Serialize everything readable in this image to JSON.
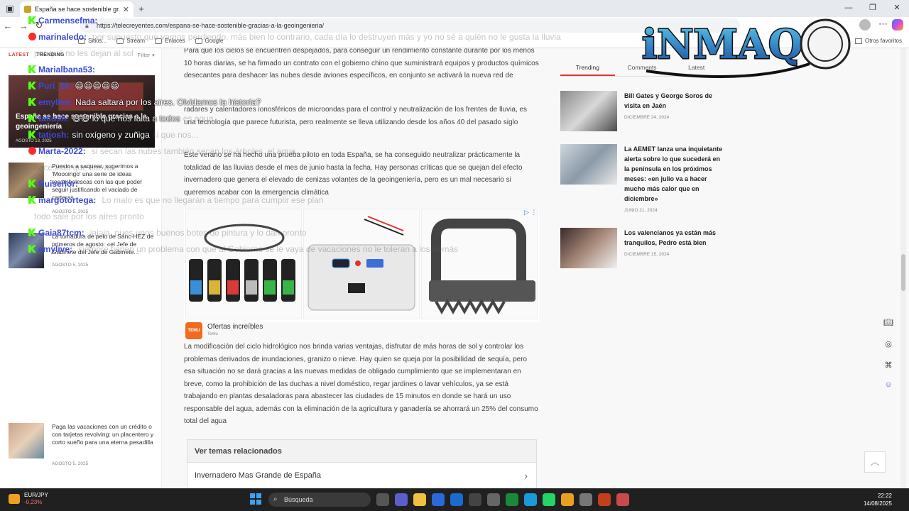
{
  "browser": {
    "tab_title": "España se hace sostenible gracias a la geoingeniería",
    "url": "https://telecreyentes.com/espana-se-hace-sostenible-gracias-a-la-geoingenieria/",
    "bookmarks": [
      "Sitios...",
      "Stream",
      "Enlaces",
      "Google"
    ],
    "other_bookmarks": "Otros favoritos"
  },
  "left": {
    "tabs": [
      "LATEST",
      "TRENDING"
    ],
    "filter": "Filter ▾",
    "featured": {
      "title": "España se hace sostenible gracias a la geoingeniería",
      "date": "AGOSTO 13, 2025"
    },
    "items": [
      {
        "title": "Puestos a saquear, sugerimos a 'Moooingo' una serie de ideas rocambolescas con las que poder seguir justificando el vaciado de carteras",
        "date": "AGOSTO 5, 2025"
      },
      {
        "title": "La tomadura de pelo de Sánc-HEZ de primeros de agosto: «el Jefe de Gabinete del Jefe de Gabinete...",
        "date": "AGOSTO 5, 2025"
      },
      {
        "title": "Paga las vacaciones con un crédito o con tarjetas revolving: un placentero y corto sueño para una eterna pesadilla",
        "date": "AGOSTO 5, 2025"
      }
    ]
  },
  "article": {
    "p1": "Para que los cielos se encuentren despejados, para conseguir un rendimiento constante durante por los menos 10 horas diarias, se ha firmado un contrato con el gobierno chino que suministrará equipos y productos químicos desecantes para deshacer las nubes desde aviones específicos, en conjunto se activará la nueva red de",
    "p2": "radares y calentadores ionosféricos de microondas para el control y neutralización de los frentes de lluvia, es una tecnología que parece futurista, pero realmente se lleva utilizando desde los años 40 del pasado siglo",
    "p3": "Este verano se ha hecho una prueba piloto en toda España, se ha conseguido neutralizar prácticamente la totalidad de las lluvias desde el mes de junio hasta la fecha. Hay personas críticas que se quejan del efecto invernadero que genera el elevado de cenizas volantes de la geoingeniería, pero es un mal necesario si queremos acabar con la emergencia climática",
    "p4": "La modificación del ciclo hidrológico nos brinda varias ventajas, disfrutar de más horas de sol y controlar los problemas derivados de inundaciones, granizo o nieve. Hay quien se queja por la posibilidad de sequía, pero esa situación no se dará gracias a las nuevas medidas de obligado cumplimiento que se implementaran en breve, como la prohibición de las duchas a nivel doméstico, regar jardines o lavar vehículos, ya se está trabajando en plantas desaladoras para abastecer las ciudades de 15 minutos en donde se hará un uso responsable del agua, además con la eliminación de la agricultura y ganadería se ahorrará un 25% del consumo total del agua",
    "ad": {
      "name": "Ofertas increíbles",
      "source": "Temu",
      "logo": "TEMU"
    },
    "related_heading": "Ver temas relacionados",
    "related_link": "Invernadero Mas Grande de España"
  },
  "right": {
    "tabs": [
      "Trending",
      "Comments",
      "Latest"
    ],
    "items": [
      {
        "title": "Bill Gates y George Soros de visita en Jaén",
        "date": "DICIEMBRE 24, 2024"
      },
      {
        "title": "La AEMET lanza una inquietante alerta sobre lo que sucederá en la península en los próximos meses: «en julio va a hacer mucho más calor que en diciembre»",
        "date": "JUNIO 21, 2024"
      },
      {
        "title": "Los valencianos ya están más tranquilos, Pedro está bien",
        "date": "DICIEMBRE 15, 2024"
      }
    ]
  },
  "chat": [
    {
      "user": "Carmensefma:",
      "text": "",
      "faded": "...",
      "badge": "kick"
    },
    {
      "user": "marinaledo:",
      "text": "",
      "faded": "por supuesto que vamos perdiendo, más bien lo contrario, cada día lo destruyen más y yo no sé a quién no le gusta la lluvia",
      "badge": "yt"
    },
    {
      "user": "",
      "text": "",
      "faded": "por qué no les dejan al sol",
      "badge": ""
    },
    {
      "user": "Marialbana53:",
      "text": "",
      "faded": "",
      "badge": "kick"
    },
    {
      "user": "Puri_28:",
      "text": "😄😄😄😄😄",
      "faded": "",
      "badge": "kick"
    },
    {
      "user": "emylive:",
      "text": "Nada saltará por los aires. Olvidamos la historia?",
      "faded": "",
      "badge": "kick"
    },
    {
      "user": "tatiosh:",
      "text": "😄😄 lo que nos falta a todos",
      "faded": "es agua",
      "badge": "kick"
    },
    {
      "user": "tatiosh:",
      "text": "sin oxígeno y zuñiga",
      "faded": "si que nos...",
      "badge": "kick"
    },
    {
      "user": "Marta-2022:",
      "text": "",
      "faded": "si secan las nubes también secan los árboles, el agua...",
      "badge": "yt"
    },
    {
      "user": "",
      "text": "",
      "faded": "necesitan que llueva",
      "badge": ""
    },
    {
      "user": "Ruiseñor:",
      "text": "",
      "faded": "",
      "badge": "kick"
    },
    {
      "user": "margotortega:",
      "text": "",
      "faded": "Lo malo es que no llegarán a tiempo para cumplir ese plan",
      "badge": "kick"
    },
    {
      "user": "",
      "text": "",
      "faded": "todo sale por los aires pronto",
      "badge": ""
    },
    {
      "user": "Gaia87tcm:",
      "text": "",
      "faded": "jajaja, pues unos buenos botes de pintura y lo dan pronto",
      "badge": "kick"
    },
    {
      "user": "emylive:",
      "text": "",
      "faded": "siempre tienen un problema con que al Gobierno se le vaya de vacaciones no le toleran a los demás",
      "badge": "kick"
    }
  ],
  "logo": {
    "text": "iNMAQ"
  },
  "taskbar": {
    "ticker": "EUR/JPY",
    "change": "-0,23%",
    "search": "Búsqueda",
    "time": "22:22",
    "date": "14/08/2025"
  },
  "colors": {
    "accent": "#d33333",
    "chat_user": "#3b4bd8",
    "kick": "#53fc18",
    "taskbar": "#202020"
  }
}
